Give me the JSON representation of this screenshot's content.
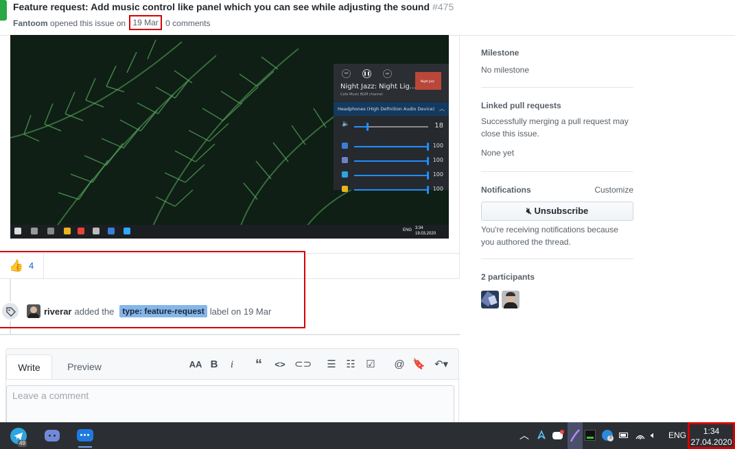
{
  "header": {
    "title": "Feature request: Add music control like panel which you can see while adjusting the sound",
    "number": "#475",
    "author": "Fantoom",
    "opened_text": "opened this issue on",
    "date": "19 Mar",
    "comments": "0 comments"
  },
  "screenshot": {
    "song_title": "Night Jazz: Night Lig...",
    "song_subtitle": "Cafe Music BGM channel",
    "thumb_caption": "Night Jazz",
    "device": "Headphones (High Definition Audio Device)",
    "master_volume": "18",
    "master_level": 0.18,
    "apps": [
      {
        "value": "100",
        "level": 1.0,
        "color": "#3b7dd8",
        "icon": "app-icon"
      },
      {
        "value": "100",
        "level": 1.0,
        "color": "#6f7fc9",
        "icon": "discord-icon"
      },
      {
        "value": "100",
        "level": 1.0,
        "color": "#2ca5e0",
        "icon": "telegram-icon"
      },
      {
        "value": "100",
        "level": 1.0,
        "color": "#e8b51b",
        "icon": "chrome-icon"
      }
    ],
    "tray_lang": "ENG",
    "tray_time": "3:34",
    "tray_date": "19.03.2020"
  },
  "reaction": {
    "emoji": "👍",
    "count": "4"
  },
  "event": {
    "user": "riverar",
    "action": "added the",
    "label": "type: feature-request",
    "suffix": "label on 19 Mar"
  },
  "editor": {
    "tab_write": "Write",
    "tab_preview": "Preview",
    "placeholder": "Leave a comment",
    "tools": [
      "text-size-icon",
      "bold-icon",
      "italic-icon",
      "quote-icon",
      "code-icon",
      "link-icon",
      "bullet-list-icon",
      "numbered-list-icon",
      "task-list-icon",
      "mention-icon",
      "bookmark-icon",
      "reply-icon"
    ]
  },
  "sidebar": {
    "milestone_heading": "Milestone",
    "milestone_value": "No milestone",
    "linked_heading": "Linked pull requests",
    "linked_desc": "Successfully merging a pull request may close this issue.",
    "linked_value": "None yet",
    "notifications_heading": "Notifications",
    "customize": "Customize",
    "unsubscribe": "Unsubscribe",
    "notif_reason": "You're receiving notifications because you authored the thread.",
    "participants_heading": "2 participants"
  },
  "taskbar": {
    "telegram_badge": "49",
    "lang": "ENG",
    "time": "1:34",
    "date": "27.04.2020"
  },
  "colors": {
    "open_green": "#28a745",
    "label_bg": "#84b6eb",
    "highlight_red": "#d50000",
    "link_blue": "#0366d6"
  }
}
